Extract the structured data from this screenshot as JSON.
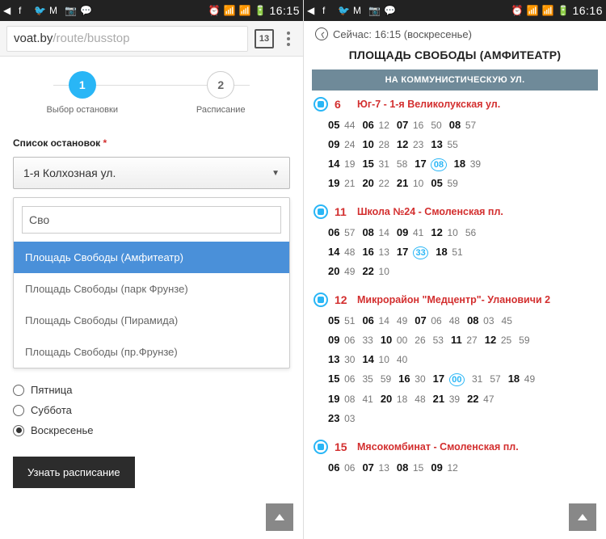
{
  "statusbar": {
    "time_left": "16:15",
    "time_right": "16:16"
  },
  "browser": {
    "url_host": "voat.by",
    "url_path": "/route/busstop",
    "tab_count": "13"
  },
  "stepper": {
    "steps": [
      {
        "num": "1",
        "label": "Выбор остановки"
      },
      {
        "num": "2",
        "label": "Расписание"
      }
    ]
  },
  "stops_field": {
    "label": "Список остановок",
    "required": "*",
    "selected": "1-я Колхозная ул.",
    "search_value": "Сво",
    "options": [
      "Площадь Свободы (Амфитеатр)",
      "Площадь Свободы (парк Фрунзе)",
      "Площадь Свободы (Пирамида)",
      "Площадь Свободы (пр.Фрунзе)"
    ]
  },
  "days": [
    "Пятница",
    "Суббота",
    "Воскресенье"
  ],
  "days_selected_index": 2,
  "submit_label": "Узнать расписание",
  "schedule": {
    "now_label": "Сейчас: 16:15 (воскресенье)",
    "stop_title": "ПЛОЩАДЬ СВОБОДЫ (АМФИТЕАТР)",
    "direction": "НА КОММУНИСТИЧЕСКУЮ УЛ.",
    "routes": [
      {
        "num": "6",
        "name": "Юг-7 - 1-я Великолукская ул.",
        "rows": [
          [
            [
              "05",
              "44"
            ],
            [
              "06",
              "12"
            ],
            [
              "07",
              "16 50"
            ],
            [
              "08",
              "57"
            ]
          ],
          [
            [
              "09",
              "24"
            ],
            [
              "10",
              "28"
            ],
            [
              "12",
              "23"
            ],
            [
              "13",
              "55"
            ]
          ],
          [
            [
              "14",
              "19"
            ],
            [
              "15",
              "31 58"
            ],
            [
              "17",
              "08",
              true
            ],
            [
              "18",
              "39"
            ]
          ],
          [
            [
              "19",
              "21"
            ],
            [
              "20",
              "22"
            ],
            [
              "21",
              "10"
            ],
            [
              "05",
              "59"
            ]
          ]
        ]
      },
      {
        "num": "11",
        "name": "Школа №24 - Смоленская пл.",
        "rows": [
          [
            [
              "06",
              "57"
            ],
            [
              "08",
              "14"
            ],
            [
              "09",
              "41"
            ],
            [
              "12",
              "10 56"
            ]
          ],
          [
            [
              "14",
              "48"
            ],
            [
              "16",
              "13"
            ],
            [
              "17",
              "33",
              true
            ],
            [
              "18",
              "51"
            ]
          ],
          [
            [
              "20",
              "49"
            ],
            [
              "22",
              "10"
            ]
          ]
        ]
      },
      {
        "num": "12",
        "name": "Микрорайон \"Медцентр\"- Улановичи 2",
        "rows": [
          [
            [
              "05",
              "51"
            ],
            [
              "06",
              "14 49"
            ],
            [
              "07",
              "06 48"
            ],
            [
              "08",
              "03 45"
            ]
          ],
          [
            [
              "09",
              "06 33"
            ],
            [
              "10",
              "00 26 53"
            ],
            [
              "11",
              "27"
            ],
            [
              "12",
              "25 59"
            ]
          ],
          [
            [
              "13",
              "30"
            ],
            [
              "14",
              "10 40"
            ]
          ],
          [
            [
              "15",
              "06 35 59"
            ],
            [
              "16",
              "30"
            ],
            [
              "17",
              "00",
              true
            ],
            [
              "",
              "31 57"
            ],
            [
              "18",
              "49"
            ]
          ],
          [
            [
              "19",
              "08 41"
            ],
            [
              "20",
              "18 48"
            ],
            [
              "21",
              "39"
            ],
            [
              "22",
              "47"
            ]
          ],
          [
            [
              "23",
              "03"
            ]
          ]
        ]
      },
      {
        "num": "15",
        "name": "Мясокомбинат - Смоленская пл.",
        "rows": [
          [
            [
              "06",
              "06"
            ],
            [
              "07",
              "13"
            ],
            [
              "08",
              "15"
            ],
            [
              "09",
              "12"
            ]
          ]
        ]
      }
    ]
  }
}
